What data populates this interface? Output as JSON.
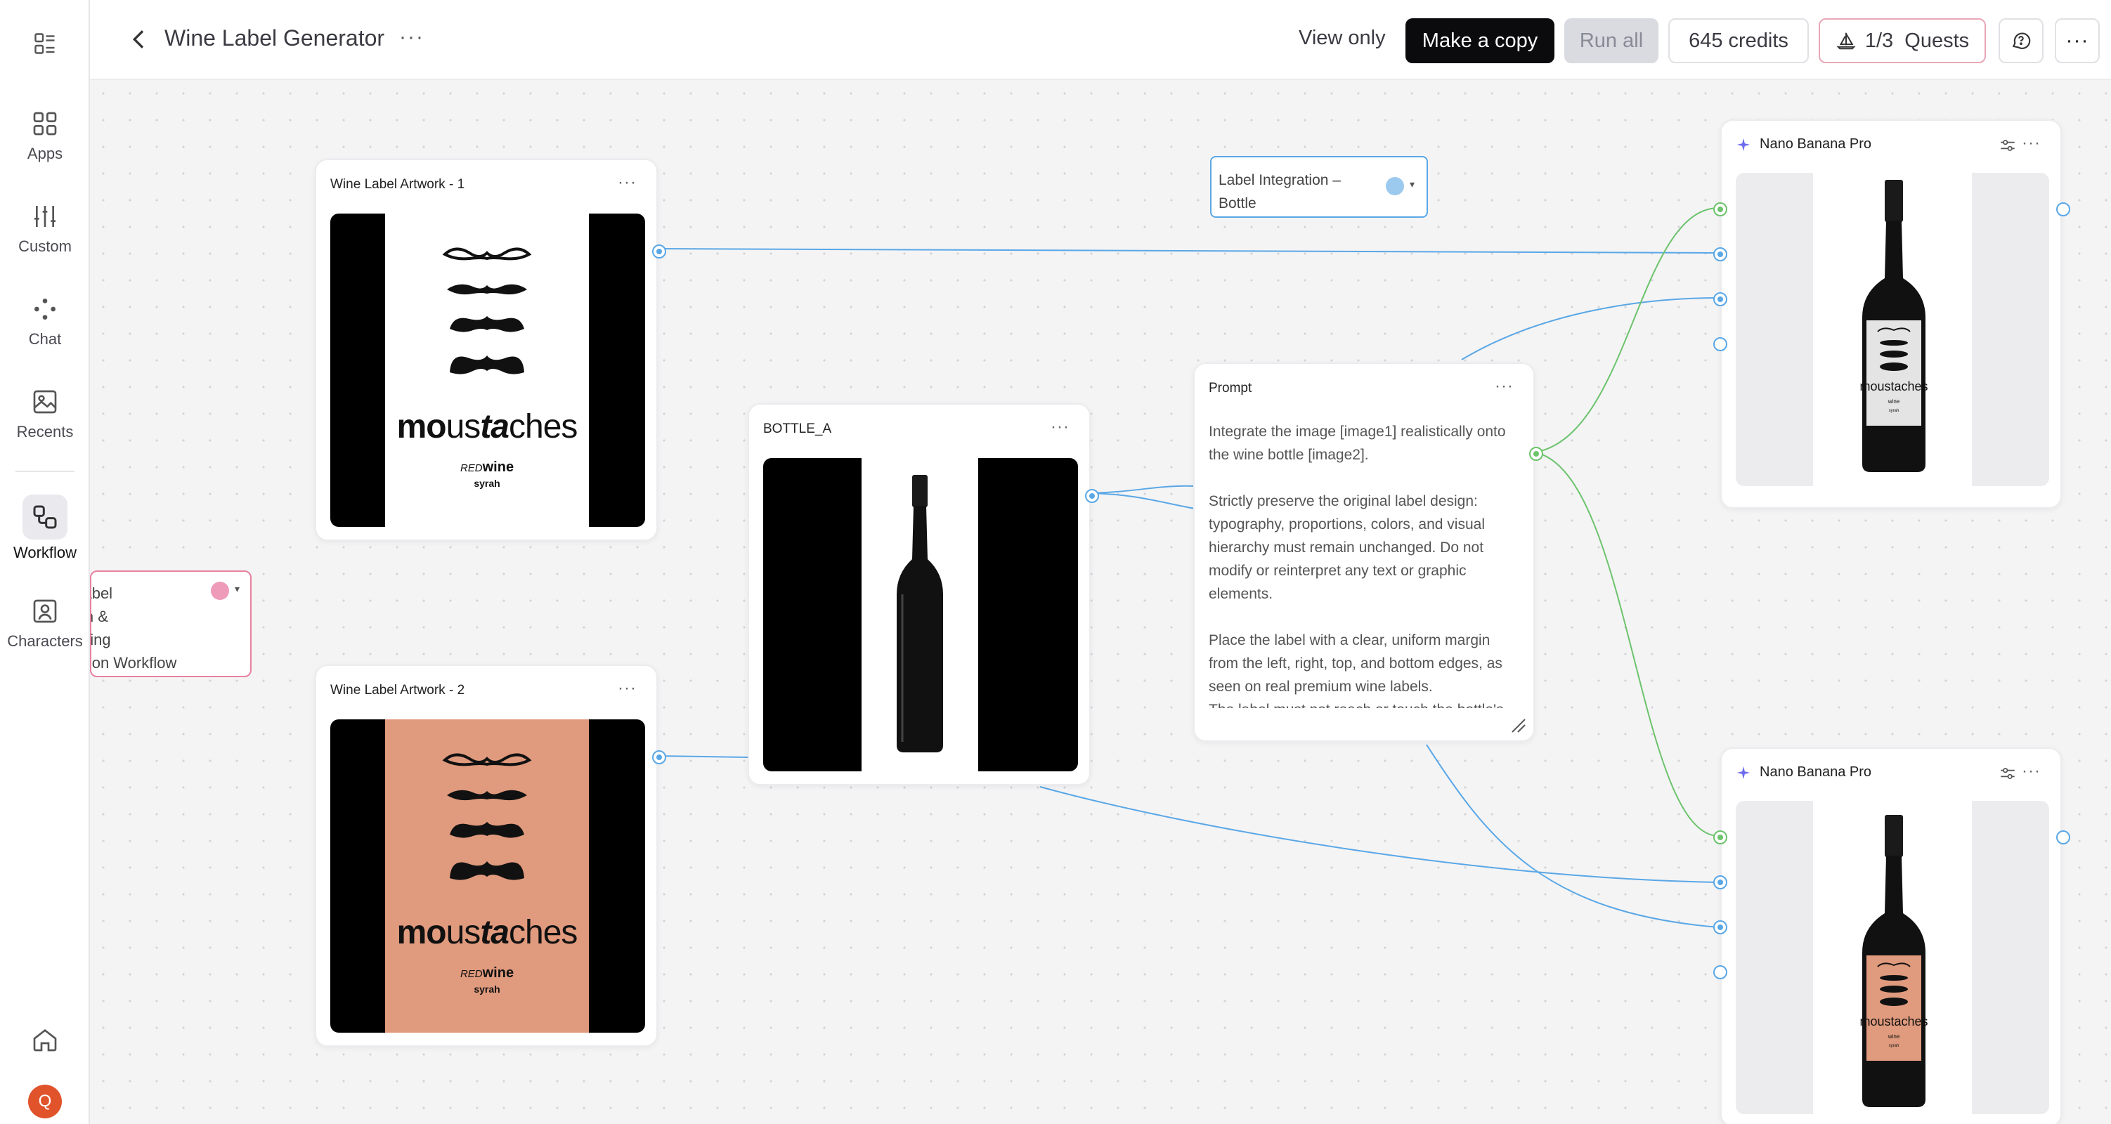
{
  "sidebar": {
    "items": [
      {
        "label": "Apps",
        "icon": "grid-icon"
      },
      {
        "label": "Custom",
        "icon": "sliders-icon"
      },
      {
        "label": "Chat",
        "icon": "chat-dots-icon"
      },
      {
        "label": "Recents",
        "icon": "images-icon"
      },
      {
        "label": "Workflow",
        "icon": "workflow-icon",
        "active": true
      },
      {
        "label": "Characters",
        "icon": "character-icon"
      }
    ],
    "avatar_initial": "Q"
  },
  "header": {
    "title": "Wine Label Generator",
    "view_only": "View only",
    "make_copy": "Make a copy",
    "run_all": "Run all",
    "credits": "645 credits",
    "quests": "1/3  Quests"
  },
  "nodes": {
    "artwork1": {
      "title": "Wine Label Artwork - 1"
    },
    "artwork2": {
      "title": "Wine Label Artwork - 2"
    },
    "bottle": {
      "title": "BOTTLE_A"
    },
    "prompt": {
      "title": "Prompt",
      "text": "Integrate the image [image1] realistically onto the wine bottle [image2].\n\nStrictly preserve the original label design: typography, proportions, colors, and visual hierarchy must remain unchanged. Do not modify or reinterpret any text or graphic elements.\n\nPlace the label with a clear, uniform margin from the left, right, top, and bottom edges, as seen on real premium wine labels.\nThe label must not reach or touch the bottle's edges."
    },
    "label_integration": {
      "text_line1": "Label Integration –",
      "text_line2": "Bottle"
    },
    "group": {
      "text": "Wine Label\nCreation &\nPositioning\nProduction Workflow"
    },
    "model1": {
      "title": "Nano Banana Pro"
    },
    "model2": {
      "title": "Nano Banana Pro"
    }
  },
  "label_art": {
    "brand": "moustaches",
    "brand_mo": "mo",
    "brand_us": "us",
    "brand_ta": "ta",
    "brand_ches": "ches",
    "red": "RED",
    "wine": "wine",
    "variety": "syrah",
    "colors": {
      "white": "#ffffff",
      "salmon": "#e09a7d",
      "black": "#000000"
    }
  },
  "colors": {
    "wire_blue": "#5aa7e6",
    "wire_green": "#6cc36c",
    "accent_pink": "#e8829f"
  }
}
